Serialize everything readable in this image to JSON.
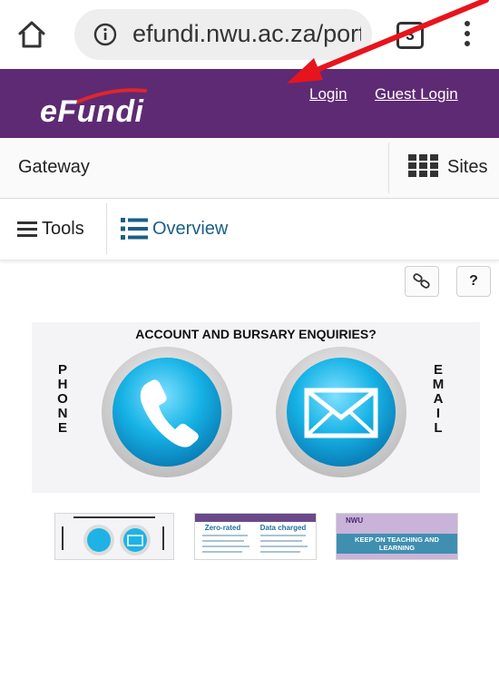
{
  "browser": {
    "url": "efundi.nwu.ac.za/porta",
    "tab_count": "3"
  },
  "header": {
    "logo": "eFundi",
    "login_label": "Login",
    "guest_login_label": "Guest Login"
  },
  "nav": {
    "gateway_label": "Gateway",
    "sites_label": "Sites",
    "tools_label": "Tools",
    "overview_label": "Overview"
  },
  "toolbar": {
    "help_label": "?"
  },
  "banner": {
    "title": "ACCOUNT AND BURSARY ENQUIRIES?",
    "left_word": [
      "P",
      "H",
      "O",
      "N",
      "E"
    ],
    "right_word": [
      "E",
      "M",
      "A",
      "I",
      "L"
    ]
  },
  "thumbnails": {
    "thumb2_headings": [
      "Zero-rated",
      "Data charged"
    ],
    "thumb3_brand": "NWU",
    "thumb3_text": "KEEP ON TEACHING AND LEARNING"
  },
  "colors": {
    "header_purple": "#5e2a74",
    "overview_blue": "#1a5f86",
    "arrow_red": "#e8141c"
  }
}
